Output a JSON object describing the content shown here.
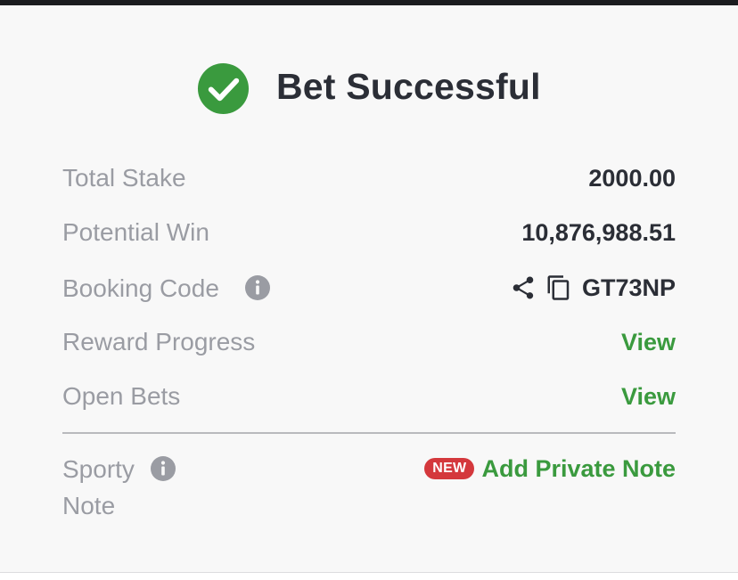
{
  "header": {
    "title": "Bet Successful",
    "accent_color": "#3a9a3e",
    "icon": "check-circle-icon"
  },
  "summary": {
    "total_stake": {
      "label": "Total Stake",
      "value": "2000.00"
    },
    "potential_win": {
      "label": "Potential Win",
      "value": "10,876,988.51"
    },
    "booking_code": {
      "label": "Booking Code",
      "value": "GT73NP",
      "info_icon": "info-icon",
      "share_icon": "share-icon",
      "copy_icon": "copy-icon"
    },
    "reward_progress": {
      "label": "Reward Progress",
      "link": "View"
    },
    "open_bets": {
      "label": "Open Bets",
      "link": "View"
    }
  },
  "note": {
    "label_line1": "Sporty",
    "label_line2": "Note",
    "info_icon": "info-icon",
    "badge": "NEW",
    "badge_color": "#d4383c",
    "action": "Add Private Note"
  }
}
